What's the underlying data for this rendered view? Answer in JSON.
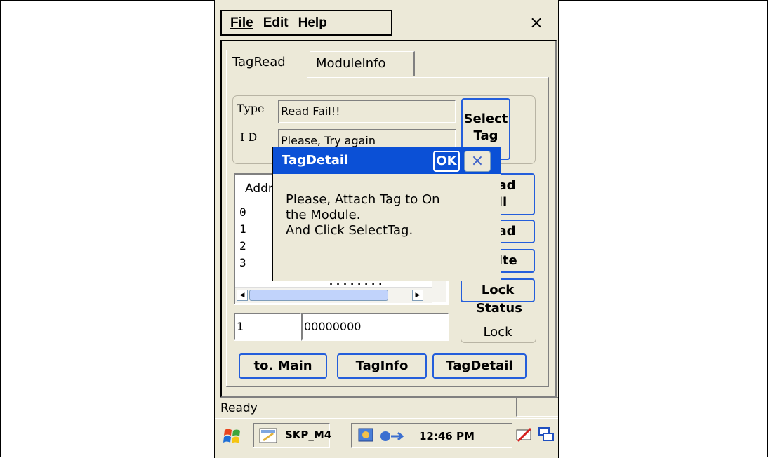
{
  "menubar": {
    "file": "File",
    "edit": "Edit",
    "help": "Help",
    "close_glyph": "×"
  },
  "tabs": [
    {
      "label": "TagRead"
    },
    {
      "label": "ModuleInfo"
    }
  ],
  "tag_group": {
    "type_label": "Type",
    "type_value": "Read Fail!!",
    "id_label": "I D",
    "id_value": "Please, Try again",
    "select_tag_line1": "Select",
    "select_tag_line2": "Tag"
  },
  "memory_list": {
    "header": "Address",
    "rows": [
      "0",
      "1",
      "2",
      "3"
    ],
    "row_value": "........"
  },
  "side_buttons": {
    "read_all_line1": "Read",
    "read_all_line2": "All",
    "read": "Read",
    "write": "Write",
    "lock": "Lock"
  },
  "address_input": {
    "value": "1"
  },
  "data_input": {
    "value": "00000000"
  },
  "status": {
    "label": "Status",
    "value": "Lock"
  },
  "bottom_buttons": {
    "to_main": "to. Main",
    "tag_info": "TagInfo",
    "tag_detail": "TagDetail"
  },
  "statusbar": {
    "text": "Ready"
  },
  "taskbar": {
    "app_button": "SKP_M4",
    "time": "12:46 PM"
  },
  "dialog": {
    "title": "TagDetail",
    "ok": "OK",
    "close_glyph": "×",
    "message": "Please, Attach Tag to On\nthe Module.\nAnd Click SelectTag."
  },
  "colors": {
    "title_blue": "#0b50d6",
    "window_bg": "#ece9d8",
    "button_border": "#245edb"
  }
}
